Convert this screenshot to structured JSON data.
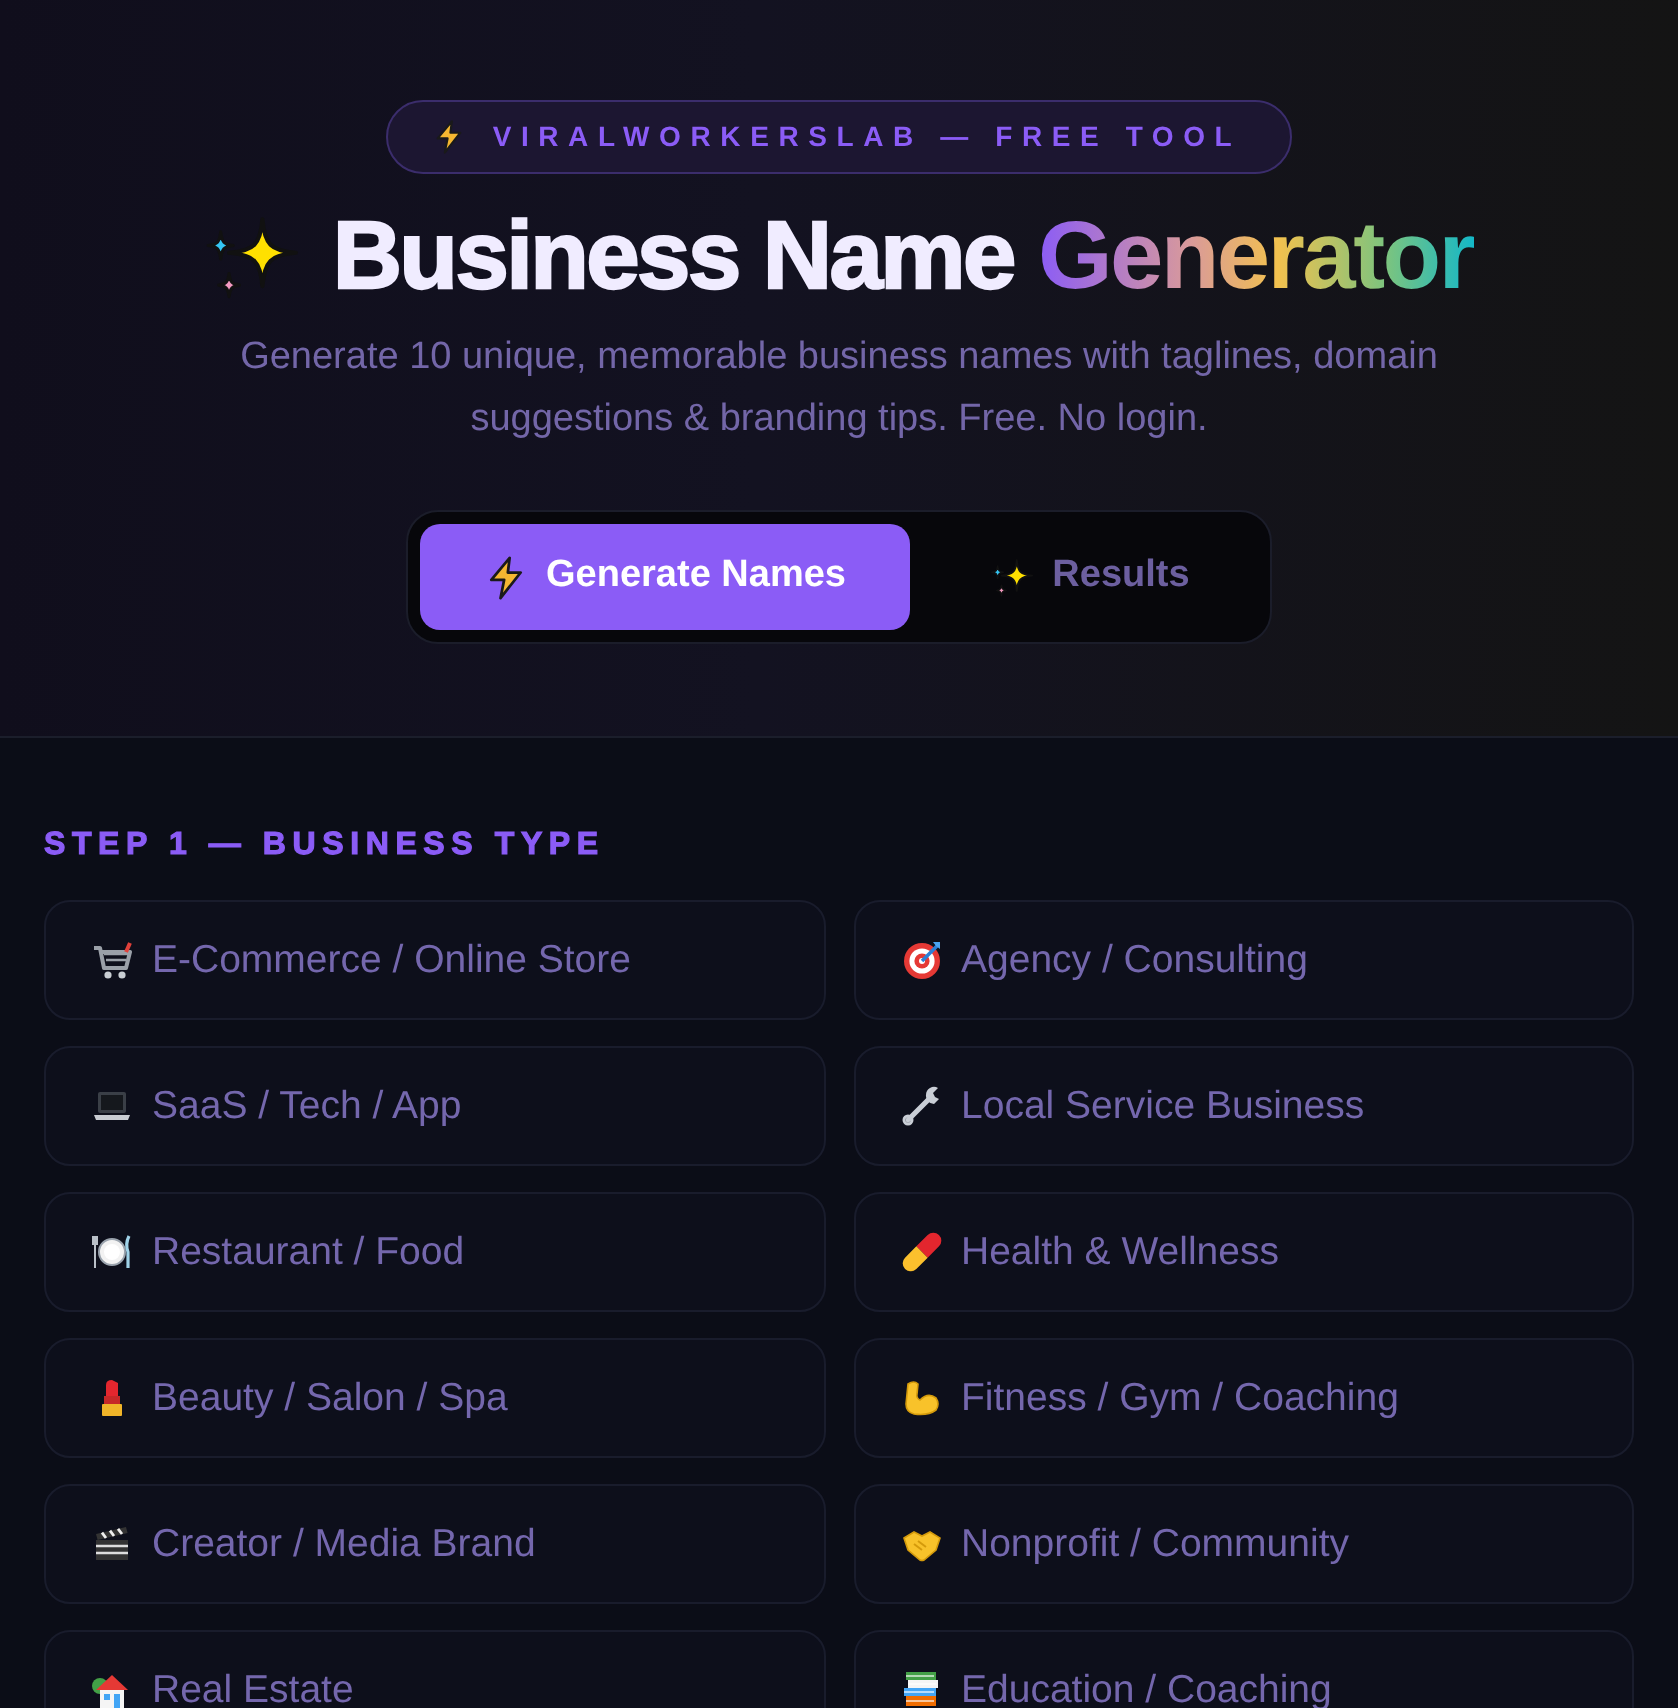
{
  "badge": {
    "text": "VIRALWORKERSLAB — FREE TOOL"
  },
  "title": {
    "text": "Business Name",
    "highlight": "Generator"
  },
  "subtitle": "Generate 10 unique, memorable business names with taglines, domain suggestions & branding tips. Free. No login.",
  "tabs": [
    {
      "label": "Generate Names",
      "selected": true
    },
    {
      "label": "Results",
      "selected": false
    }
  ],
  "step": {
    "title": "STEP 1 — BUSINESS TYPE",
    "options": [
      {
        "label": "E-Commerce / Online Store",
        "selected": false
      },
      {
        "label": "Agency / Consulting",
        "selected": false
      },
      {
        "label": "SaaS / Tech / App",
        "selected": false
      },
      {
        "label": "Local Service Business",
        "selected": false
      },
      {
        "label": "Restaurant / Food",
        "selected": false
      },
      {
        "label": "Health & Wellness",
        "selected": false
      },
      {
        "label": "Beauty / Salon / Spa",
        "selected": false
      },
      {
        "label": "Fitness / Gym / Coaching",
        "selected": false
      },
      {
        "label": "Creator / Media Brand",
        "selected": false
      },
      {
        "label": "Nonprofit / Community",
        "selected": false
      },
      {
        "label": "Real Estate",
        "selected": false
      },
      {
        "label": "Education / Coaching",
        "selected": false
      }
    ]
  }
}
